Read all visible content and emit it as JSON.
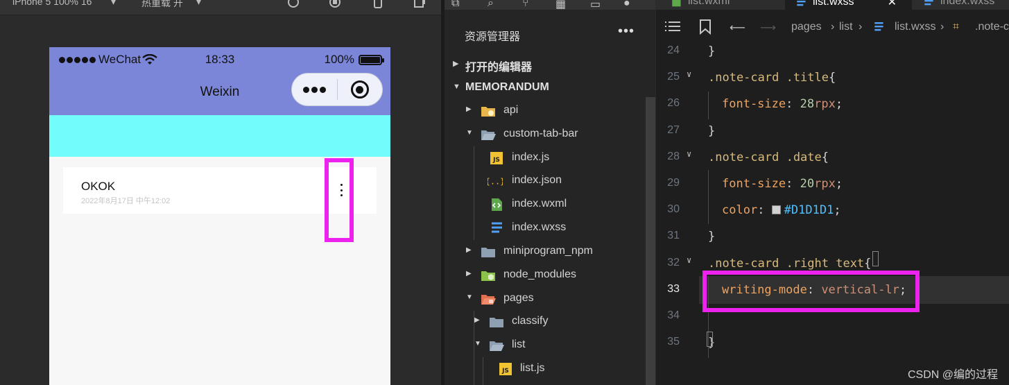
{
  "simulator": {
    "toolbar": {
      "device_label": "iPhone 5 100% 16",
      "hot_reload_label": "热重载 开"
    },
    "status_bar": {
      "carrier": "WeChat",
      "time": "18:33",
      "battery": "100%"
    },
    "nav_title": "Weixin",
    "note_card": {
      "title": "OKOK",
      "date": "2022年8月17日 中午12:02"
    },
    "highlight_color": "#ee22ee"
  },
  "explorer": {
    "title": "资源管理器",
    "more_label": "•••",
    "sections": {
      "open_editors": "打开的编辑器",
      "project": "MEMORANDUM"
    },
    "tree": [
      {
        "label": "api",
        "icon": "folder-api-icon",
        "depth": 0,
        "expanded": false
      },
      {
        "label": "custom-tab-bar",
        "icon": "folder-open-icon",
        "depth": 0,
        "expanded": true
      },
      {
        "label": "index.js",
        "icon": "js-file-icon",
        "depth": 1
      },
      {
        "label": "index.json",
        "icon": "json-file-icon",
        "depth": 1
      },
      {
        "label": "index.wxml",
        "icon": "wxml-file-icon",
        "depth": 1
      },
      {
        "label": "index.wxss",
        "icon": "css-file-icon",
        "depth": 1
      },
      {
        "label": "miniprogram_npm",
        "icon": "folder-icon",
        "depth": 0,
        "expanded": false
      },
      {
        "label": "node_modules",
        "icon": "folder-node-icon",
        "depth": 0,
        "expanded": false
      },
      {
        "label": "pages",
        "icon": "folder-pages-icon",
        "depth": 0,
        "expanded": true
      },
      {
        "label": "classify",
        "icon": "folder-icon",
        "depth": 1,
        "expanded": false
      },
      {
        "label": "list",
        "icon": "folder-open-icon",
        "depth": 1,
        "expanded": true
      },
      {
        "label": "list.js",
        "icon": "js-file-icon",
        "depth": 2
      }
    ]
  },
  "editor": {
    "tabs": [
      {
        "label": "list.wxml",
        "icon": "wxml-file-icon",
        "active": false
      },
      {
        "label": "list.wxss",
        "icon": "css-file-icon",
        "active": true
      },
      {
        "label": "index.wxss",
        "icon": "css-file-icon",
        "active": false
      }
    ],
    "breadcrumbs": {
      "seg1": "pages",
      "seg2": "list",
      "seg3": "list.wxss",
      "seg4": ".note-c"
    },
    "lines": [
      {
        "n": "24",
        "tokens": [
          {
            "t": "}",
            "c": "brace"
          }
        ]
      },
      {
        "n": "25",
        "tokens": [
          {
            "t": ".note-card .title",
            "c": "sel"
          },
          {
            "t": "{",
            "c": "brace"
          }
        ]
      },
      {
        "n": "26",
        "tokens": [
          {
            "t": "font-size",
            "c": "prop2"
          },
          {
            "t": ": ",
            "c": "punc"
          },
          {
            "t": "28",
            "c": "num"
          },
          {
            "t": "rpx",
            "c": "unit"
          },
          {
            "t": ";",
            "c": "punc"
          }
        ]
      },
      {
        "n": "27",
        "tokens": [
          {
            "t": "}",
            "c": "brace"
          }
        ]
      },
      {
        "n": "28",
        "tokens": [
          {
            "t": ".note-card .date",
            "c": "sel"
          },
          {
            "t": "{",
            "c": "brace"
          }
        ]
      },
      {
        "n": "29",
        "tokens": [
          {
            "t": "font-size",
            "c": "prop2"
          },
          {
            "t": ": ",
            "c": "punc"
          },
          {
            "t": "20",
            "c": "num"
          },
          {
            "t": "rpx",
            "c": "unit"
          },
          {
            "t": ";",
            "c": "punc"
          }
        ]
      },
      {
        "n": "30",
        "tokens": [
          {
            "t": "color",
            "c": "prop2"
          },
          {
            "t": ": ",
            "c": "punc"
          },
          {
            "t": "#D1D1D1",
            "c": "hex",
            "swatch": "#D1D1D1"
          },
          {
            "t": ";",
            "c": "punc"
          }
        ]
      },
      {
        "n": "31",
        "tokens": [
          {
            "t": "}",
            "c": "brace"
          }
        ]
      },
      {
        "n": "32",
        "tokens": [
          {
            "t": ".note-card .right text",
            "c": "sel"
          },
          {
            "t": "{",
            "c": "brace"
          }
        ]
      },
      {
        "n": "33",
        "tokens": [
          {
            "t": "writing-mode",
            "c": "prop2"
          },
          {
            "t": ": ",
            "c": "punc"
          },
          {
            "t": "vertical-lr",
            "c": "prop"
          },
          {
            "t": ";",
            "c": "punc"
          }
        ]
      },
      {
        "n": "34",
        "tokens": []
      },
      {
        "n": "35",
        "tokens": [
          {
            "t": "}",
            "c": "brace"
          }
        ]
      }
    ],
    "current_line": "33",
    "watermark": "CSDN @编的过程"
  }
}
